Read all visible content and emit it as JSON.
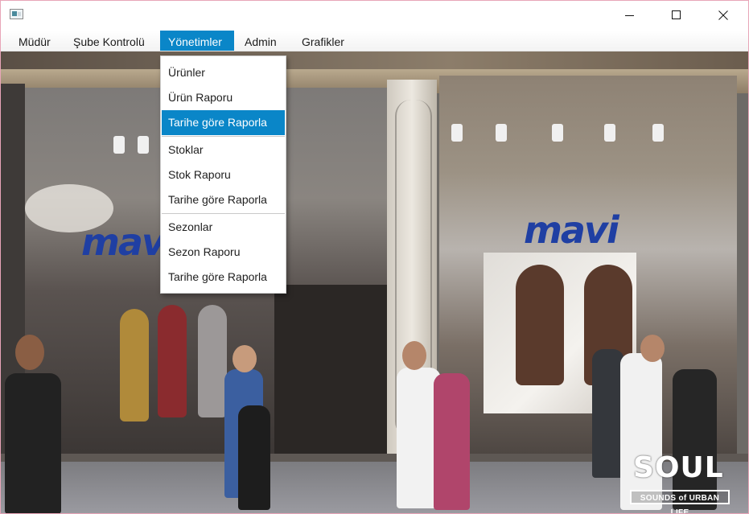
{
  "window": {
    "controls": {
      "minimize_icon": "minimize-icon",
      "maximize_icon": "maximize-icon",
      "close_icon": "close-icon"
    }
  },
  "menubar": {
    "items": [
      {
        "label": "Müdür"
      },
      {
        "label": "Şube Kontrolü"
      },
      {
        "label": "Yönetimler"
      },
      {
        "label": "Admin"
      },
      {
        "label": "Grafikler"
      }
    ],
    "active_index": 2
  },
  "dropdown": {
    "items": [
      {
        "label": "Ürünler"
      },
      {
        "label": "Ürün Raporu"
      },
      {
        "label": "Tarihe göre Raporla"
      },
      {
        "label": "Stoklar"
      },
      {
        "label": "Stok Raporu"
      },
      {
        "label": "Tarihe göre Raporla"
      },
      {
        "label": "Sezonlar"
      },
      {
        "label": "Sezon Raporu"
      },
      {
        "label": "Tarihe göre Raporla"
      }
    ],
    "highlighted_index": 2
  },
  "background_photo": {
    "store_sign_left": "mavi",
    "store_sign_right": "mavi",
    "logo_title": "SOUL",
    "logo_subtitle": "SOUNDS of URBAN LIFE"
  },
  "colors": {
    "accent": "#0a86c8",
    "window_border": "#e8a5b8",
    "sign_blue": "#1f3fa3"
  }
}
